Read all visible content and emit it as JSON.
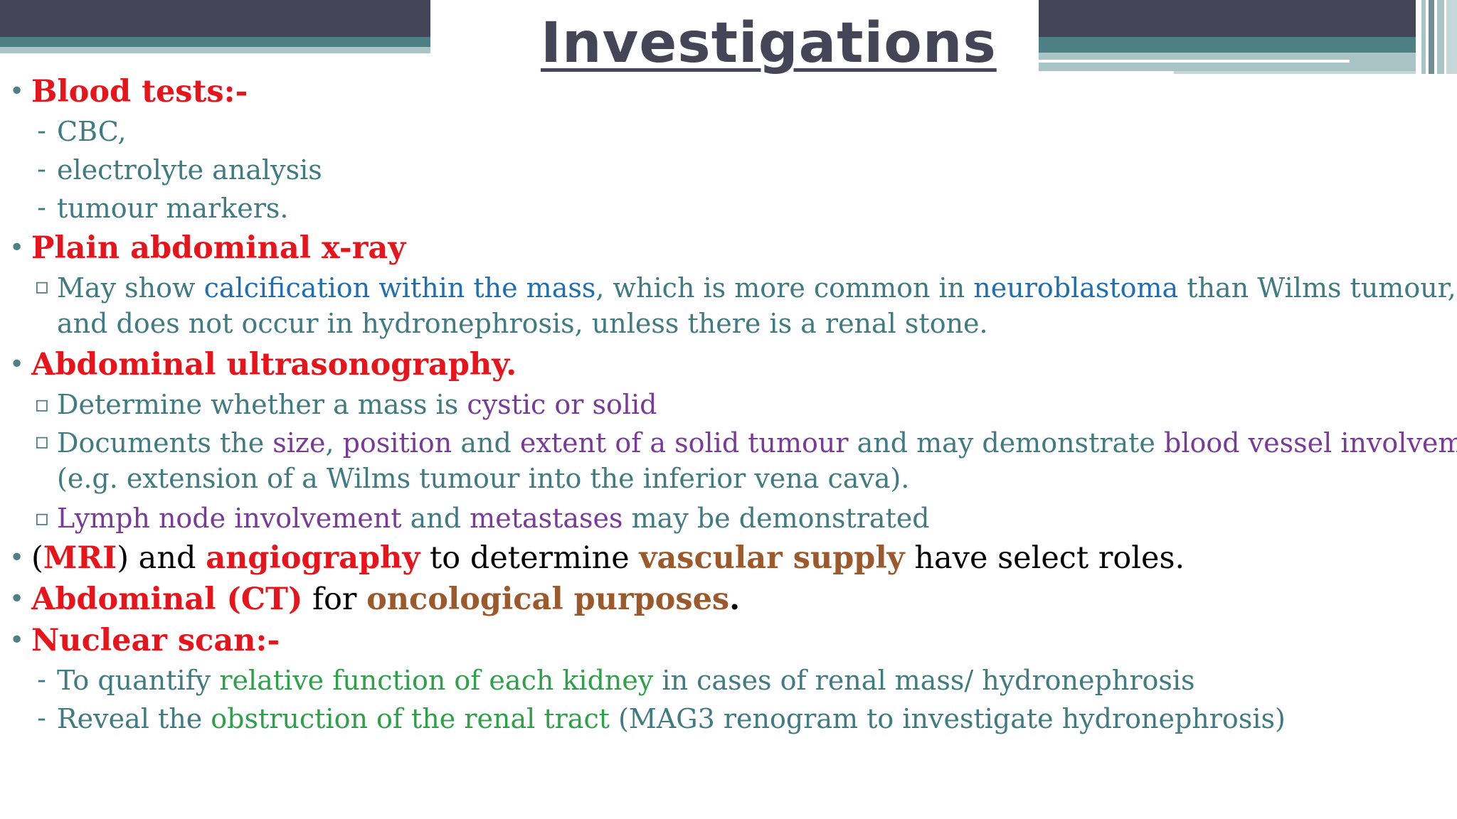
{
  "title": "Investigations",
  "blood": {
    "heading": "Blood tests:-",
    "items": [
      "CBC,",
      "electrolyte analysis",
      "tumour markers."
    ]
  },
  "xray": {
    "heading": "Plain abdominal x-ray",
    "t1": "May show ",
    "h1": "calcification within the mass",
    "t2": ", which is more common in ",
    "h2": "neuroblastoma",
    "t3": " than Wilms tumour,",
    "line2": "and does not occur in hydronephrosis, unless there is a renal stone."
  },
  "us": {
    "heading": "Abdominal ultrasonography.",
    "i1_t1": "Determine whether a mass is ",
    "i1_h1": "cystic or solid",
    "i2_t1": "Documents the ",
    "i2_h1": "size",
    "i2_t2": ", ",
    "i2_h2": "position",
    "i2_t3": " and ",
    "i2_h3": "extent of a solid tumour",
    "i2_t4": " and may demonstrate ",
    "i2_h4": "blood vessel involvement",
    "i2_line2": "(e.g. extension of a Wilms tumour into the inferior vena cava).",
    "i3_h1": "Lymph node involvement",
    "i3_t1": " and ",
    "i3_h2": "metastases",
    "i3_t2": " may be demonstrated"
  },
  "mri": {
    "p1": "(",
    "h1": "MRI",
    "p2": ") and ",
    "h2": "angiography",
    "p3": " to determine ",
    "h3": "vascular supply",
    "p4": " have select roles."
  },
  "ct": {
    "h1": "Abdominal (CT)",
    "p1": " for ",
    "h2": "oncological purposes",
    "p2": "."
  },
  "nuclear": {
    "heading": "Nuclear scan:-",
    "i1_t1": "To quantify ",
    "i1_h1": "relative function of each kidney",
    "i1_t2": " in cases of renal mass/ hydronephrosis",
    "i2_t1": "Reveal the ",
    "i2_h1": "obstruction of the renal tract",
    "i2_t2": " (MAG3 renogram to investigate hydronephrosis)"
  },
  "colors": {
    "heading_red": "#e8141b",
    "emphasis_brown": "#9c5a2c",
    "link_blue": "#1f6fb1",
    "accent_purple": "#7a3a9a",
    "accent_green": "#2fa04a",
    "body_teal": "#3f7b80",
    "bar_dark": "#464457",
    "bar_teal": "#4d8085"
  }
}
